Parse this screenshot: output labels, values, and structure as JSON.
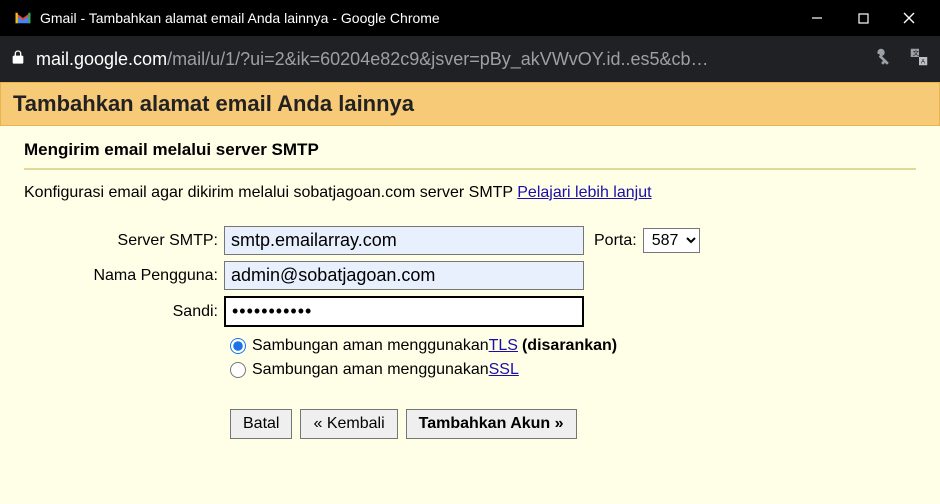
{
  "window": {
    "title": "Gmail - Tambahkan alamat email Anda lainnya - Google Chrome"
  },
  "address": {
    "host": "mail.google.com",
    "path": "/mail/u/1/?ui=2&ik=60204e82c9&jsver=pBy_akVWvOY.id..es5&cb…"
  },
  "banner": {
    "title": "Tambahkan alamat email Anda lainnya"
  },
  "subheader": "Mengirim email melalui server SMTP",
  "description": {
    "prefix": "Konfigurasi email agar dikirim melalui sobatjagoan.com server SMTP ",
    "link": "Pelajari lebih lanjut"
  },
  "form": {
    "smtp_label": "Server SMTP:",
    "smtp_value": "smtp.emailarray.com",
    "port_label": "Porta:",
    "port_value": "587",
    "user_label": "Nama Pengguna:",
    "user_value": "admin@sobatjagoan.com",
    "pwd_label": "Sandi:",
    "pwd_value": "•••••••••••"
  },
  "security": {
    "tls_prefix": "Sambungan aman menggunakan ",
    "tls_link": "TLS",
    "tls_suffix": "(disarankan)",
    "ssl_prefix": "Sambungan aman menggunakan ",
    "ssl_link": "SSL"
  },
  "buttons": {
    "cancel": "Batal",
    "back": "« Kembali",
    "add": "Tambahkan Akun »"
  }
}
